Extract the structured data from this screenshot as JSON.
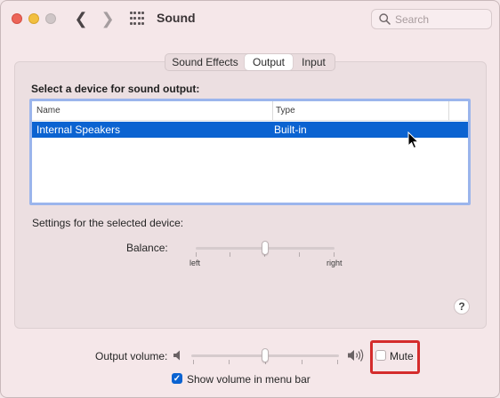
{
  "window": {
    "title": "Sound"
  },
  "search": {
    "placeholder": "Search"
  },
  "tabs": [
    {
      "label": "Sound Effects",
      "selected": false
    },
    {
      "label": "Output",
      "selected": true
    },
    {
      "label": "Input",
      "selected": false
    }
  ],
  "output": {
    "heading": "Select a device for sound output:",
    "columns": [
      "Name",
      "Type"
    ],
    "devices": [
      {
        "name": "Internal Speakers",
        "type": "Built-in",
        "selected": true
      }
    ],
    "settings_label": "Settings for the selected device:",
    "balance": {
      "label": "Balance:",
      "left_label": "left",
      "right_label": "right",
      "value": 0.5
    }
  },
  "help": {
    "label": "?"
  },
  "volume": {
    "label": "Output volume:",
    "value": 0.5,
    "mute_label": "Mute",
    "mute_checked": false,
    "menu_bar_label": "Show volume in menu bar",
    "menu_bar_checked": true
  },
  "icons": {
    "back": "chevron-left-icon",
    "forward": "chevron-right-icon",
    "all_prefs": "grid-icon",
    "search": "search-icon",
    "volume_low": "speaker-low-icon",
    "volume_high": "speaker-high-icon"
  },
  "colors": {
    "selection": "#0b63d1",
    "focus_ring": "#9bb5ec",
    "highlight_box": "#d42c2c"
  }
}
